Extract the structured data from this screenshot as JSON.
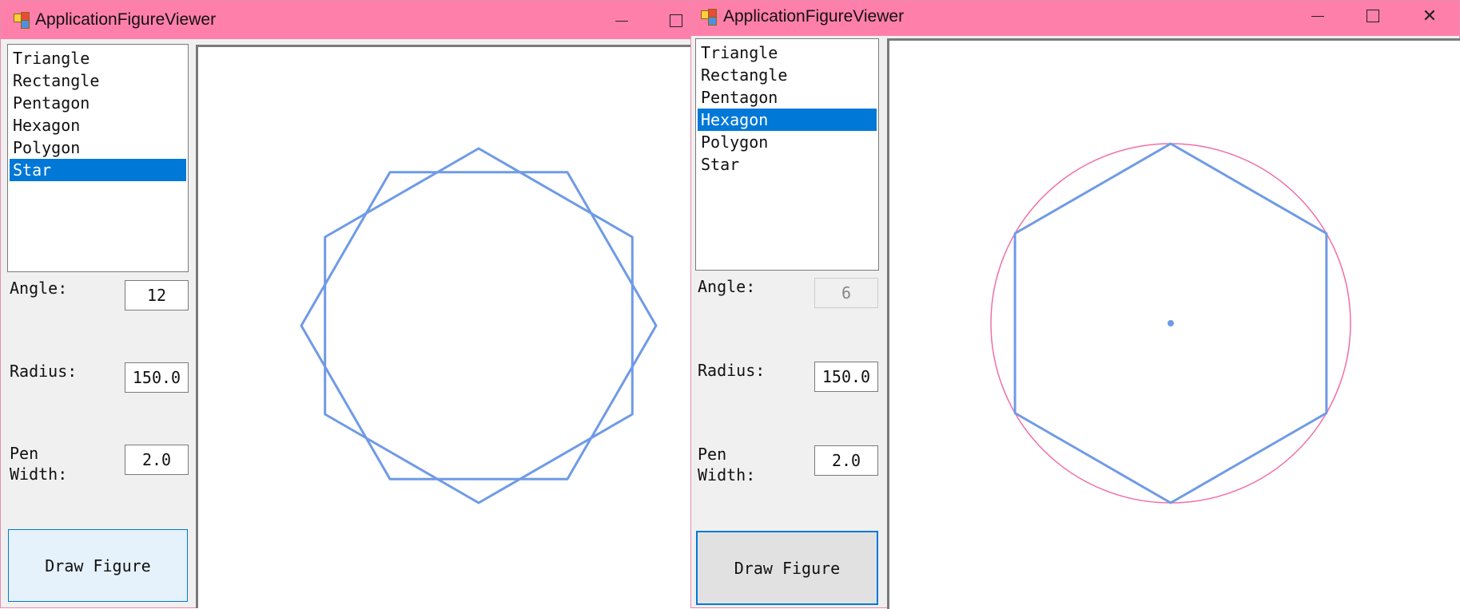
{
  "windows": [
    {
      "title": "ApplicationFigureViewer",
      "list_items": [
        "Triangle",
        "Rectangle",
        "Pentagon",
        "Hexagon",
        "Polygon",
        "Star"
      ],
      "selected": "Star",
      "angle_label": "Angle:",
      "angle_value": "12",
      "radius_label": "Radius:",
      "radius_value": "150.0",
      "pen_label": "Pen\nWidth:",
      "pen_value": "2.0",
      "draw_button": "Draw Figure",
      "figure": {
        "type": "star",
        "vertices": 12,
        "radius": 150.0,
        "pen_width": 2.0,
        "color": "#6f9ae6"
      }
    },
    {
      "title": "ApplicationFigureViewer",
      "list_items": [
        "Triangle",
        "Rectangle",
        "Pentagon",
        "Hexagon",
        "Polygon",
        "Star"
      ],
      "selected": "Hexagon",
      "angle_label": "Angle:",
      "angle_value": "6",
      "radius_label": "Radius:",
      "radius_value": "150.0",
      "pen_label": "Pen\nWidth:",
      "pen_value": "2.0",
      "draw_button": "Draw Figure",
      "figure": {
        "type": "hexagon",
        "vertices": 6,
        "radius": 150.0,
        "pen_width": 2.0,
        "color": "#6f9ae6",
        "circumcircle_color": "#f06fa8",
        "show_center": true
      }
    }
  ],
  "colors": {
    "titlebar": "#ff7fab",
    "selection": "#0078d7",
    "figure": "#6f9ae6",
    "circle": "#f06fa8"
  },
  "icons": {
    "window_controls": [
      "minimize-icon",
      "maximize-icon",
      "close-icon"
    ]
  }
}
